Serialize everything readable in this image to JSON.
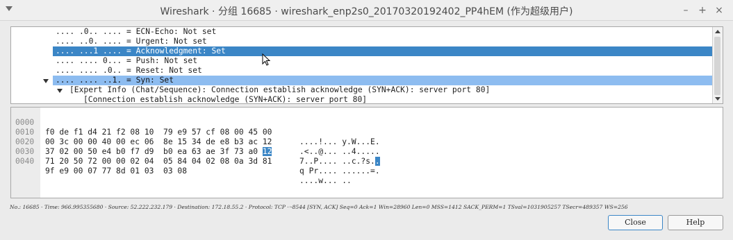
{
  "window": {
    "title": "Wireshark · 分组 16685 · wireshark_enp2s0_20170320192402_PP4hEM (作为超级用户)",
    "minimize": "–",
    "maximize": "+",
    "close": "×"
  },
  "tree": {
    "rows": [
      ".... .0.. .... = ECN-Echo: Not set",
      ".... ..0. .... = Urgent: Not set",
      ".... ...1 .... = Acknowledgment: Set",
      ".... .... 0... = Push: Not set",
      ".... .... .0.. = Reset: Not set",
      ".... .... ..1. = Syn: Set",
      "[Expert Info (Chat/Sequence): Connection establish acknowledge (SYN+ACK): server port 80]",
      "[Connection establish acknowledge (SYN+ACK): server port 80]"
    ]
  },
  "hex": {
    "rows": [
      {
        "offset": "0000",
        "bytes": "f0 de f1 d4 21 f2 08 10  79 e9 57 cf 08 00 45 00",
        "ascii": "....!... y.W...E."
      },
      {
        "offset": "0010",
        "bytes": "00 3c 00 00 40 00 ec 06  8e 15 34 de e8 b3 ac 12",
        "ascii": ".<..@... ..4....."
      },
      {
        "offset": "0020",
        "bytes_pre": "37 02 00 50 e4 b0 f7 d9  b0 ea 63 ae 3f 73 a0 ",
        "bytes_mark": "12",
        "ascii_pre": "7..P.... ..c.?s.",
        "ascii_mark": "."
      },
      {
        "offset": "0030",
        "bytes": "71 20 50 72 00 00 02 04  05 84 04 02 08 0a 3d 81",
        "ascii": "q Pr.... ......=."
      },
      {
        "offset": "0040",
        "bytes": "9f e9 00 07 77 8d 01 03  03 08",
        "ascii": "....w... .."
      }
    ]
  },
  "status": "No.: 16685 · Time: 966.995355680 · Source: 52.222.232.179 · Destination: 172.18.55.2 · Protocol: TCP ·‧·8544 [SYN, ACK] Seq=0 Ack=1 Win=28960 Len=0 MSS=1412 SACK_PERM=1 TSval=1031905257 TSecr=489357 WS=256",
  "buttons": {
    "close": "Close",
    "help": "Help"
  }
}
